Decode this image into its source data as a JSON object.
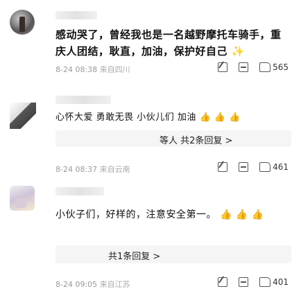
{
  "comments": [
    {
      "text": "感动哭了，曾经我也是一名越野摩托车骑手，重庆人团结，耿直，加油，保护好自己",
      "emoji": "✨",
      "date": "8-24 08:38",
      "location": "来自四川",
      "likes": "565"
    },
    {
      "text": "心怀大爱 勇敢无畏 小伙儿们 加油",
      "emoji": "👍 👍 👍",
      "date": "8-24 08:37",
      "location": "来自云南",
      "likes": "461",
      "reply_text": "等人  共2条回复 >"
    },
    {
      "text": "小伙子们，好样的，注意安全第一。",
      "emoji": "👍 👍 👍",
      "date": "8-24 09:05",
      "location": "来自江苏",
      "likes": "401",
      "reply_text": "共1条回复 >"
    }
  ]
}
